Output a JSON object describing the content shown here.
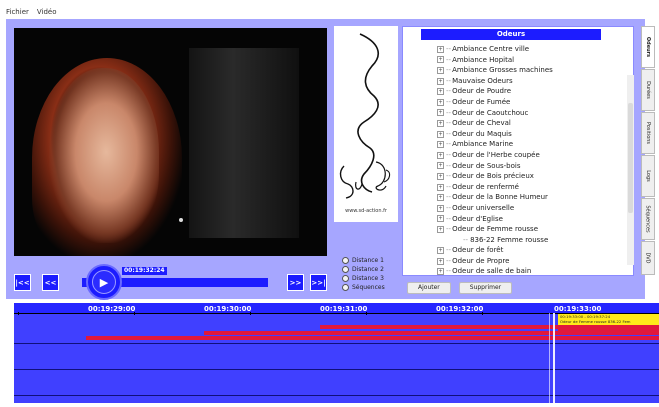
{
  "menu": {
    "file": "Fichier",
    "video": "Vidéo"
  },
  "player": {
    "current_time": "00:19:32:24",
    "buttons": {
      "prev_all": "|<<",
      "prev": "<<",
      "next": ">>",
      "next_all": ">>|"
    }
  },
  "logo": {
    "url": "www.sd-action.fr"
  },
  "distance_options": [
    "Distance 1",
    "Distance 2",
    "Distance 3",
    "Séquences"
  ],
  "odeurs": {
    "title": "Odeurs",
    "items": [
      {
        "label": "Ambiance Centre ville"
      },
      {
        "label": "Ambiance Hopital"
      },
      {
        "label": "Ambiance Grosses machines"
      },
      {
        "label": "Mauvaise Odeurs"
      },
      {
        "label": "Odeur de Poudre"
      },
      {
        "label": "Odeur de Fumée"
      },
      {
        "label": "Odeur de Caoutchouc"
      },
      {
        "label": "Odeur de Cheval"
      },
      {
        "label": "Odeur du Maquis"
      },
      {
        "label": "Ambiance Marine"
      },
      {
        "label": "Odeur de l'Herbe coupée"
      },
      {
        "label": "Odeur de Sous-bois"
      },
      {
        "label": "Odeur de Bois précieux"
      },
      {
        "label": "Odeur de renfermé"
      },
      {
        "label": "Odeur de la Bonne Humeur"
      },
      {
        "label": "Odeur universelle"
      },
      {
        "label": "Odeur d'Eglise"
      },
      {
        "label": "Odeur de Femme rousse"
      },
      {
        "label": "836-22 Femme rousse",
        "child": true
      },
      {
        "label": "Odeur de forêt"
      },
      {
        "label": "Odeur de Propre"
      },
      {
        "label": "Odeur de salle de bain"
      }
    ],
    "add_button": "Ajouter",
    "remove_button": "Supprimer"
  },
  "side_tabs": [
    "Odeurs",
    "Durées",
    "Positions",
    "Logs",
    "Séquences",
    "DVD"
  ],
  "timeline": {
    "ruler_labels": [
      "00:19:29:00",
      "00:19:30:00",
      "00:19:31:00",
      "00:19:32:00",
      "00:19:33:00"
    ],
    "event_lines": [
      "00:19:33:00 - 00:19:37:24",
      "Odeur de Femme rousse 836-22 Fem"
    ]
  },
  "colors": {
    "accent": "#1c1cff",
    "panel": "#a6a6ff",
    "track": "#4040ff",
    "segment": "#e0183c",
    "event": "#ffeb1a"
  }
}
